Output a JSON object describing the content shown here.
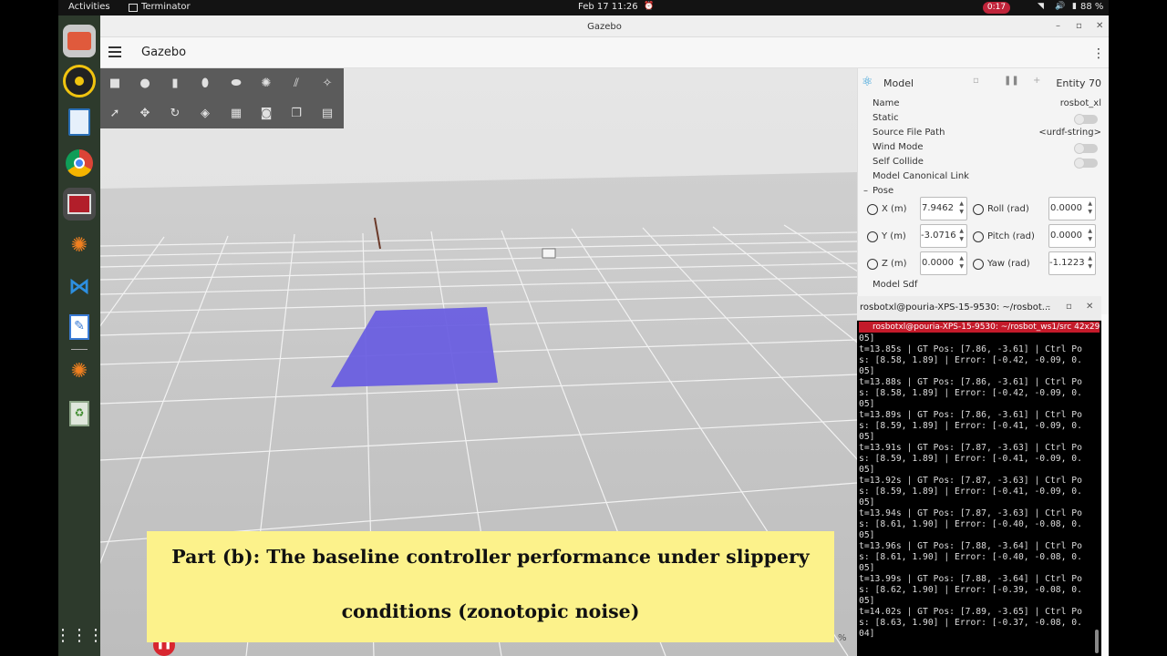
{
  "topbar": {
    "activities": "Activities",
    "app_name": "Terminator",
    "datetime": "Feb 17  11:26",
    "record_time": "0:17",
    "battery": "88 %"
  },
  "dock": {
    "items": [
      "files-icon",
      "rhythmbox-icon",
      "libreoffice-impress-icon",
      "chrome-icon",
      "terminator-icon",
      "blender-icon",
      "vscode-icon",
      "text-editor-icon",
      "blender-icon-2",
      "trash-icon",
      "app-grid-icon"
    ]
  },
  "window": {
    "title": "Gazebo",
    "app_title": "Gazebo"
  },
  "panel": {
    "header": "Model",
    "entity": "Entity 70",
    "name_label": "Name",
    "name_value": "rosbot_xl",
    "static_label": "Static",
    "source_label": "Source File Path",
    "source_value": "<urdf-string>",
    "wind_label": "Wind Mode",
    "collide_label": "Self Collide",
    "canonical_label": "Model Canonical Link",
    "pose_label": "Pose",
    "x_label": "X (m)",
    "x_value": "7.9462",
    "y_label": "Y (m)",
    "y_value": "-3.0716",
    "z_label": "Z (m)",
    "z_value": "0.0000",
    "roll_label": "Roll (rad)",
    "roll_value": "0.0000",
    "pitch_label": "Pitch (rad)",
    "pitch_value": "0.0000",
    "yaw_label": "Yaw (rad)",
    "yaw_value": "-1.1223",
    "sdf_label": "Model Sdf"
  },
  "terminal": {
    "title": "rosbotxl@pouria-XPS-15-9530: ~/rosbot...",
    "tab": "rosbotxl@pouria-XPS-15-9530: ~/rosbot_ws1/src 42x29",
    "lines": [
      "05]",
      "t=13.85s | GT Pos: [7.86, -3.61] | Ctrl Po",
      "s: [8.58, 1.89] | Error: [-0.42, -0.09, 0.",
      "05]",
      "t=13.88s | GT Pos: [7.86, -3.61] | Ctrl Po",
      "s: [8.58, 1.89] | Error: [-0.42, -0.09, 0.",
      "05]",
      "t=13.89s | GT Pos: [7.86, -3.61] | Ctrl Po",
      "s: [8.59, 1.89] | Error: [-0.41, -0.09, 0.",
      "05]",
      "t=13.91s | GT Pos: [7.87, -3.63] | Ctrl Po",
      "s: [8.59, 1.89] | Error: [-0.41, -0.09, 0.",
      "05]",
      "t=13.92s | GT Pos: [7.87, -3.63] | Ctrl Po",
      "s: [8.59, 1.89] | Error: [-0.41, -0.09, 0.",
      "05]",
      "t=13.94s | GT Pos: [7.87, -3.63] | Ctrl Po",
      "s: [8.61, 1.90] | Error: [-0.40, -0.08, 0.",
      "05]",
      "t=13.96s | GT Pos: [7.88, -3.64] | Ctrl Po",
      "s: [8.61, 1.90] | Error: [-0.40, -0.08, 0.",
      "05]",
      "t=13.99s | GT Pos: [7.88, -3.64] | Ctrl Po",
      "s: [8.62, 1.90] | Error: [-0.39, -0.08, 0.",
      "05]",
      "t=14.02s | GT Pos: [7.89, -3.65] | Ctrl Po",
      "s: [8.63, 1.90] | Error: [-0.37, -0.08, 0.",
      "04]"
    ]
  },
  "caption": {
    "line1": "Part (b): The baseline controller performance under slippery",
    "line2": "conditions (zonotopic noise)"
  },
  "status": {
    "percent": "%"
  },
  "colors": {
    "accent_red": "#c41a2a",
    "caption_bg": "#fcf28b",
    "patch": "#6a5fe0"
  }
}
